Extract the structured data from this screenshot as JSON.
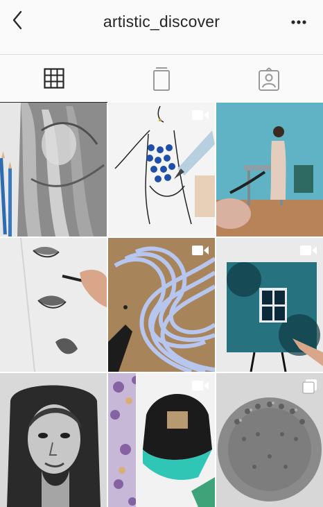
{
  "header": {
    "username": "artistic_discover",
    "back_icon": "chevron-left-icon",
    "more_icon": "more-horizontal-icon"
  },
  "tabs": [
    {
      "icon": "grid-icon",
      "active": true
    },
    {
      "icon": "igtv-icon",
      "active": false
    },
    {
      "icon": "tagged-user-icon",
      "active": false
    }
  ],
  "posts": [
    {
      "subject": "pencil drawing of draped fabric figure",
      "badge": "none"
    },
    {
      "subject": "line drawing of woman with blue push pins",
      "badge": "video-icon"
    },
    {
      "subject": "painting of woman at desk in teal room",
      "badge": "none"
    },
    {
      "subject": "pencil sketches of lips",
      "badge": "none"
    },
    {
      "subject": "braided blue rope pattern on cardboard",
      "badge": "video-icon"
    },
    {
      "subject": "painting of window on teal canvas",
      "badge": "video-icon"
    },
    {
      "subject": "charcoal portrait of woman",
      "badge": "none"
    },
    {
      "subject": "painting a black cap with teal paint",
      "badge": "video-icon"
    },
    {
      "subject": "grey sculpted dots circle",
      "badge": "carousel-icon"
    }
  ],
  "colors": {
    "text": "#262626",
    "divider": "#dbdbdb",
    "background": "#fafafa"
  }
}
